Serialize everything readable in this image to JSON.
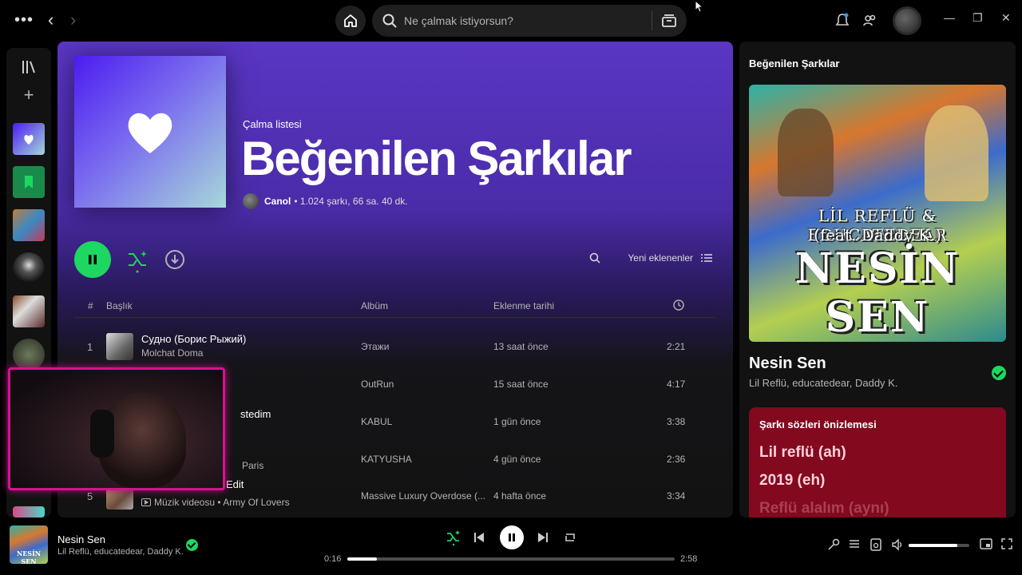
{
  "topbar": {
    "search_placeholder": "Ne çalmak istiyorsun?"
  },
  "playlist": {
    "type_label": "Çalma listesi",
    "title": "Beğenilen Şarkılar",
    "owner": "Canol",
    "meta": "• 1.024 şarkı, 66 sa. 40 dk.",
    "sort_label": "Yeni eklenenler"
  },
  "table": {
    "headers": {
      "num": "#",
      "title": "Başlık",
      "album": "Albüm",
      "added": "Eklenme tarihi"
    },
    "rows": [
      {
        "num": "1",
        "title": "Судно (Борис Рыжий)",
        "artist": "Molchat Doma",
        "album": "Этажи",
        "added": "13 saat önce",
        "duration": "2:21"
      },
      {
        "num": "",
        "title": "",
        "artist": "",
        "album": "OutRun",
        "added": "15 saat önce",
        "duration": "4:17"
      },
      {
        "num": "",
        "title": "stedim",
        "artist": "",
        "album": "KABUL",
        "added": "1 gün önce",
        "duration": "3:38"
      },
      {
        "num": "",
        "title": "",
        "artist": "Paris",
        "album": "KATYUSHA",
        "added": "4 gün önce",
        "duration": "2:36"
      },
      {
        "num": "5",
        "title": "Edit",
        "artist": "Müzik videosu • Army Of Lovers",
        "album": "Massive Luxury Overdose (...",
        "added": "4 hafta önce",
        "duration": "3:34"
      }
    ]
  },
  "now_playing_panel": {
    "title": "Beğenilen Şarkılar",
    "art_line1": "LİL REFLÜ & EDUCATEDEAR",
    "art_line2": "(feat. Daddy K.)",
    "art_line3": "NESİN SEN",
    "song": "Nesin Sen",
    "artists": "Lil Reflü, educatedear, Daddy K.",
    "lyrics_header": "Şarkı sözleri önizlemesi",
    "lyrics": [
      "Lil reflü (ah)",
      "2019 (eh)",
      "Reflü alalım (aynı)"
    ]
  },
  "player": {
    "title": "Nesin Sen",
    "artist": "Lil Reflü, educatedear, Daddy K.",
    "thumb_text": "NESİN SEN",
    "elapsed": "0:16",
    "total": "2:58",
    "progress": 0.09,
    "volume": 0.8
  },
  "colors": {
    "accent": "#1ed760",
    "gradient_top": "#5a36c4",
    "lyrics_bg": "#82091e"
  }
}
